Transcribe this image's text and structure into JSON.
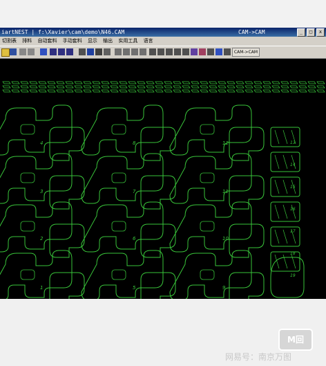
{
  "window": {
    "title": "iartNEST  |  f:\\Xavier\\cam\\demo\\N46.CAM",
    "center_title": "CAM->CAM",
    "min": "_",
    "max": "□",
    "close": "x"
  },
  "menu": [
    "切割表",
    "排料",
    "自动套料",
    "手动套料",
    "显示",
    "输出",
    "实用工具",
    "语言"
  ],
  "toolbar": {
    "cam_label": "CAM->CAM"
  },
  "part_numbers": [
    "4",
    "8",
    "12",
    "3",
    "7",
    "11",
    "2",
    "6",
    "10",
    "1",
    "5",
    "9"
  ],
  "right_numbers": [
    "13",
    "14",
    "15",
    "16",
    "17",
    "18",
    "19"
  ],
  "colors": {
    "background": "#000000",
    "part_outline": "#39c43a",
    "frame": "#3a6ea5"
  },
  "watermark": {
    "logo": "M回",
    "text": "网易号：南京万图"
  }
}
